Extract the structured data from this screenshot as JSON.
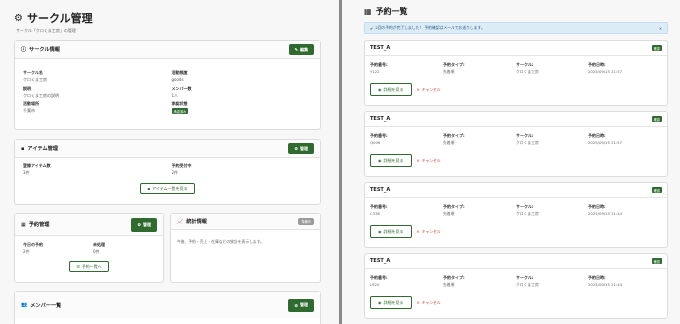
{
  "left": {
    "title": "サークル管理",
    "subtitle": "サークル「クロくま工房」の管理",
    "circle_info": {
      "title": "サークル情報",
      "edit_label": "編集",
      "fields": [
        {
          "label": "サークル名",
          "value": "クロくま工房"
        },
        {
          "label": "活動頻度",
          "value": "goods"
        },
        {
          "label": "説明",
          "value": "クロくま工房の説明"
        },
        {
          "label": "メンバー数",
          "value": "1人"
        },
        {
          "label": "活動場所",
          "value": "千葉市"
        },
        {
          "label": "承認状態",
          "value": "承認済み"
        }
      ]
    },
    "item_mgmt": {
      "title": "アイテム管理",
      "manage_label": "管理",
      "fields": [
        {
          "label": "登録アイテム数",
          "value": "3件"
        },
        {
          "label": "予約受付中",
          "value": "2件"
        }
      ],
      "list_button": "アイテム一覧を見る"
    },
    "reservation_mgmt": {
      "title": "予約管理",
      "manage_label": "管理",
      "fields": [
        {
          "label": "今日の予約",
          "value": "2件"
        },
        {
          "label": "未処理",
          "value": "0件"
        }
      ],
      "list_button": "予約一覧へ"
    },
    "stats": {
      "title": "統計情報",
      "badge": "準備中",
      "text": "今後、予約・売上・在庫などの統計を表示します。"
    },
    "members": {
      "title": "メンバー一覧",
      "manage_label": "管理"
    }
  },
  "right": {
    "title": "予約一覧",
    "alert": "2回の予約が完了しました！ 予約確認はメールでお送りします。",
    "columns": {
      "number": "予約番号:",
      "type": "予約タイプ:",
      "circle": "サークル:",
      "datetime": "予約日時:"
    },
    "detail_label": "詳細を見る",
    "cancel_label": "キャンセル",
    "reservations": [
      {
        "name": "TEST_A",
        "badge": "確認",
        "number": "Y122",
        "type": "先着順",
        "circle": "クロくま工房",
        "datetime": "2025/09/15 21:57"
      },
      {
        "name": "TEST_A",
        "badge": "確認",
        "number": "Q096",
        "type": "先着順",
        "circle": "クロくま工房",
        "datetime": "2025/09/15 21:57"
      },
      {
        "name": "TEST_A",
        "badge": "確認",
        "number": "C336",
        "type": "先着順",
        "circle": "クロくま工房",
        "datetime": "2025/09/15 21:44"
      },
      {
        "name": "TEST_A",
        "badge": "確認",
        "number": "L920",
        "type": "先着順",
        "circle": "クロくま工房",
        "datetime": "2025/09/15 21:44"
      }
    ]
  }
}
